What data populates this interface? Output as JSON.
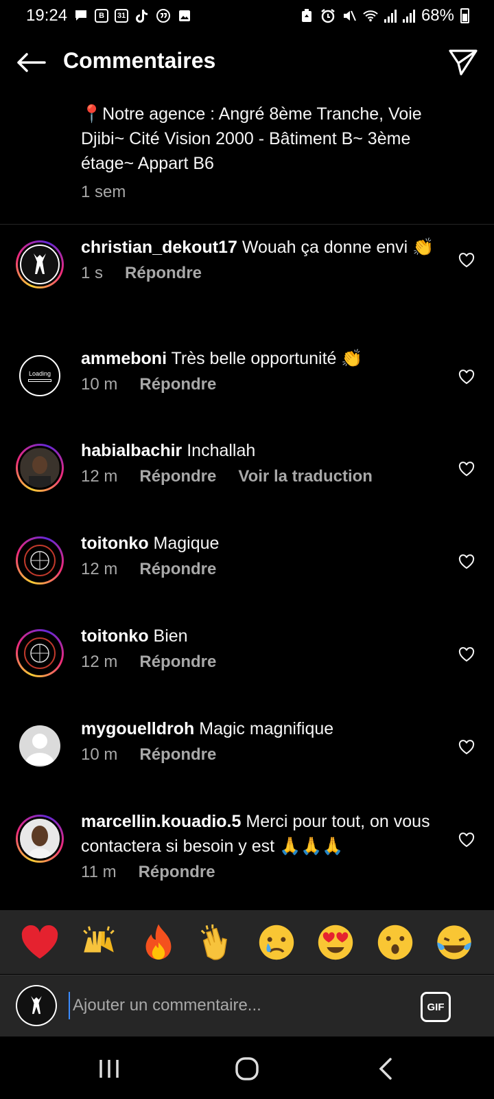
{
  "status_bar": {
    "time": "19:24",
    "battery": "68%",
    "left_icons": [
      "message-icon",
      "b-app-icon",
      "calendar-31-icon",
      "tiktok-icon",
      "quote-icon",
      "image-icon"
    ],
    "right_icons": [
      "recycle-icon",
      "alarm-icon",
      "mute-icon",
      "wifi-icon",
      "signal-icon",
      "signal-icon",
      "battery-icon"
    ],
    "calendar_day": "31",
    "b_letter": "B"
  },
  "header": {
    "title": "Commentaires",
    "back_icon": "arrow-left-icon",
    "send_icon": "paper-plane-icon"
  },
  "caption": {
    "text": "📍Notre agence : Angré 8ème Tranche, Voie Djibi~ Cité Vision 2000 - Bâtiment B~ 3ème étage~ Appart B6",
    "time": "1 sem"
  },
  "comments": [
    {
      "username": "christian_dekout17",
      "text": "Wouah ça donne envi 👏",
      "time": "1 s",
      "reply": "Répondre"
    },
    {
      "username": "ammeboni",
      "text": "Très belle opportunité 👏",
      "time": "10 m",
      "reply": "Répondre",
      "avatar_label": "Loading"
    },
    {
      "username": "habialbachir",
      "text": "Inchallah",
      "time": "12 m",
      "reply": "Répondre",
      "translate": "Voir la traduction"
    },
    {
      "username": "toitonko",
      "text": "Magique",
      "time": "12 m",
      "reply": "Répondre"
    },
    {
      "username": "toitonko",
      "text": "Bien",
      "time": "12 m",
      "reply": "Répondre"
    },
    {
      "username": "mygouelldroh",
      "text": "Magic magnifique",
      "time": "10 m",
      "reply": "Répondre"
    },
    {
      "username": "marcellin.kouadio.5",
      "text": "Merci pour tout, on vous contactera si besoin y est 🙏🙏🙏",
      "time": "11 m",
      "reply": "Répondre"
    }
  ],
  "reactions": [
    "❤️",
    "🙌",
    "🔥",
    "👏",
    "😢",
    "😍",
    "😮",
    "😂"
  ],
  "composer": {
    "placeholder": "Ajouter un commentaire...",
    "gif_label": "GIF"
  },
  "colors": {
    "background": "#000000",
    "secondary_text": "#a8a8a8",
    "surface": "#262626",
    "cursor": "#3a8cff"
  }
}
